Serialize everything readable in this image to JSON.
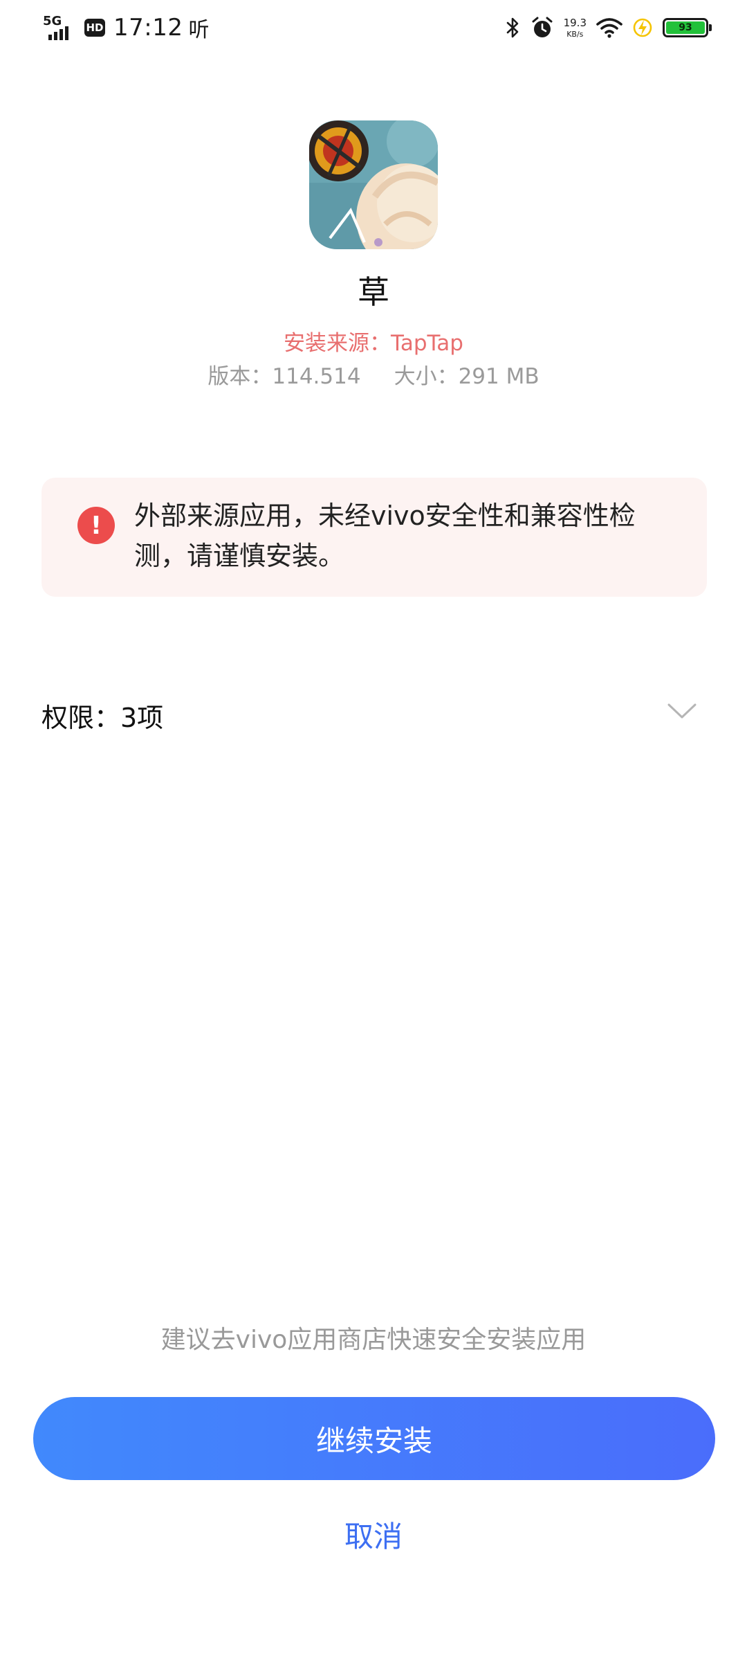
{
  "status_bar": {
    "network": "5G",
    "hd": "HD",
    "time": "17:12",
    "listen": "听",
    "speed_value": "19.3",
    "speed_unit": "KB/s",
    "battery": "93",
    "icons": [
      "bluetooth-icon",
      "alarm-icon",
      "wifi-icon",
      "charging-icon",
      "battery-icon"
    ]
  },
  "app": {
    "name": "草",
    "source": "安装来源：TapTap",
    "version": "版本：114.514",
    "size": "大小：291 MB"
  },
  "warning": {
    "icon": "exclamation-icon",
    "text": "外部来源应用，未经vivo安全性和兼容性检测，请谨慎安装。"
  },
  "permissions": {
    "label": "权限：3项",
    "icon": "chevron-down-icon"
  },
  "footer": {
    "suggestion": "建议去vivo应用商店快速安全安装应用",
    "continue_label": "继续安装",
    "cancel_label": "取消"
  },
  "colors": {
    "source_red": "#e86f6f",
    "warning_bg": "#fdf3f2",
    "warning_icon": "#ec4c4c",
    "button_gradient_start": "#4189fc",
    "button_gradient_end": "#4a6dfb",
    "cancel_blue": "#3d6ff2",
    "battery_green": "#22c13a"
  }
}
